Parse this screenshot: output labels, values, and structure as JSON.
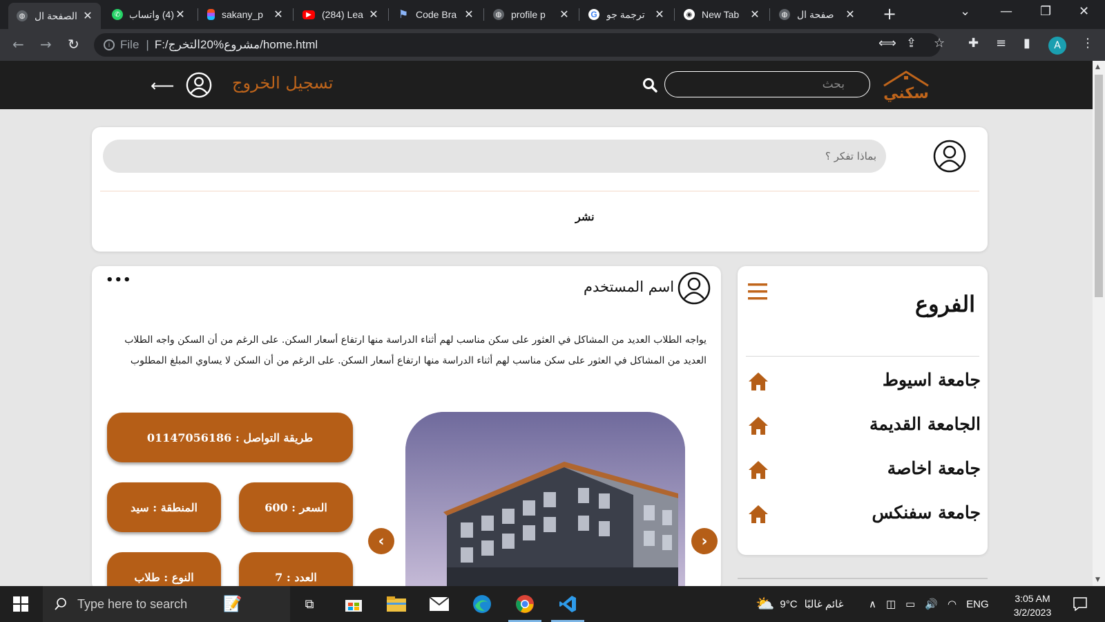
{
  "browser": {
    "tabs": [
      {
        "title": "الصفحة ال",
        "favicon": "globe-icon",
        "active": true
      },
      {
        "title": "(4) واتساب",
        "favicon": "whatsapp-icon"
      },
      {
        "title": "sakany_p",
        "favicon": "figma-icon"
      },
      {
        "title": "(284) Lea",
        "favicon": "youtube-icon"
      },
      {
        "title": "Code Bra",
        "favicon": "flag-icon"
      },
      {
        "title": "profile p",
        "favicon": "globe-icon"
      },
      {
        "title": "ترجمة جو",
        "favicon": "google-icon"
      },
      {
        "title": "New Tab",
        "favicon": "chrome-icon"
      },
      {
        "title": "صفحة ال",
        "favicon": "globe-icon"
      }
    ],
    "url_scheme": "File",
    "url": "F:/مشروع%20التخرج/home.html",
    "profile_initial": "A"
  },
  "site": {
    "logo_text": "سكني",
    "search_placeholder": "بحث",
    "logout_label": "تسجيل الخروج",
    "brand_color": "#c0651b"
  },
  "composer": {
    "placeholder": "بماذا تفكر ؟",
    "publish_label": "نشر"
  },
  "post": {
    "username": "اسم المستخدم",
    "more_label": "•••",
    "body": "يواجه الطلاب العديد من المشاكل في العثور على سكن مناسب لهم أثناء الدراسة منها ارتفاع أسعار السكن. على الرغم من أن السكن واجه الطلاب العديد من المشاكل في العثور على سكن مناسب لهم أثناء الدراسة منها ارتفاع أسعار السكن. على الرغم من أن السكن لا يساوي المبلغ المطلوب",
    "contact": "طريقة التواصل : 01147056186",
    "price": "السعر : 600",
    "area": "المنطقة : سيد",
    "count": "العدد : 7",
    "type": "النوع : طلاب"
  },
  "branches": {
    "title": "الفروع",
    "items": [
      {
        "label": "جامعة اسيوط"
      },
      {
        "label": "الجامعة القديمة"
      },
      {
        "label": "جامعة اخاصة"
      },
      {
        "label": "جامعة سفنكس"
      }
    ]
  },
  "taskbar": {
    "search_placeholder": "Type here to search",
    "weather_temp": "9°C",
    "weather_text": "غائم غالبًا",
    "language": "ENG",
    "time": "3:05 AM",
    "date": "3/2/2023"
  }
}
